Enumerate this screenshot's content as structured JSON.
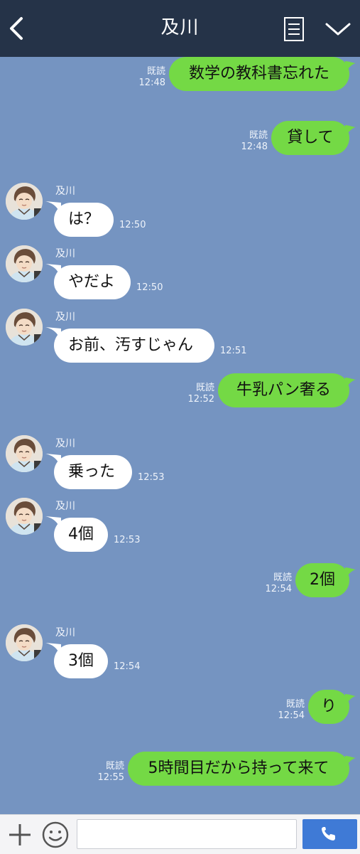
{
  "header": {
    "title": "及川",
    "back_icon": "back-chevron-icon",
    "menu_icon": "note-menu-icon",
    "expand_icon": "chevron-down-icon",
    "bg_color": "#253348"
  },
  "chat": {
    "bg_color": "#7594c1",
    "incoming_color": "#ffffff",
    "outgoing_color": "#74d945",
    "messages": [
      {
        "dir": "out",
        "text": "数学の教科書忘れた",
        "read": "既読",
        "time": "12:48"
      },
      {
        "dir": "out",
        "text": "貸して",
        "read": "既読",
        "time": "12:48"
      },
      {
        "dir": "in",
        "sender": "及川",
        "text": "は？",
        "time": "12:50"
      },
      {
        "dir": "in",
        "sender": "及川",
        "text": "やだよ",
        "time": "12:50"
      },
      {
        "dir": "in",
        "sender": "及川",
        "text": "お前、汚すじゃん",
        "time": "12:51"
      },
      {
        "dir": "out",
        "text": "牛乳パン奢る",
        "read": "既読",
        "time": "12:52"
      },
      {
        "dir": "in",
        "sender": "及川",
        "text": "乗った",
        "time": "12:53"
      },
      {
        "dir": "in",
        "sender": "及川",
        "text": "4個",
        "time": "12:53"
      },
      {
        "dir": "out",
        "text": "2個",
        "read": "既読",
        "time": "12:54"
      },
      {
        "dir": "in",
        "sender": "及川",
        "text": "3個",
        "time": "12:54"
      },
      {
        "dir": "out",
        "text": "り",
        "read": "既読",
        "time": "12:54"
      },
      {
        "dir": "out",
        "text": "5時間目だから持って来て",
        "read": "既読",
        "time": "12:55"
      }
    ]
  },
  "footer": {
    "plus_icon": "plus-icon",
    "emoji_icon": "smiley-icon",
    "input_placeholder": "",
    "call_icon": "phone-icon",
    "call_color": "#3f7ad6"
  }
}
